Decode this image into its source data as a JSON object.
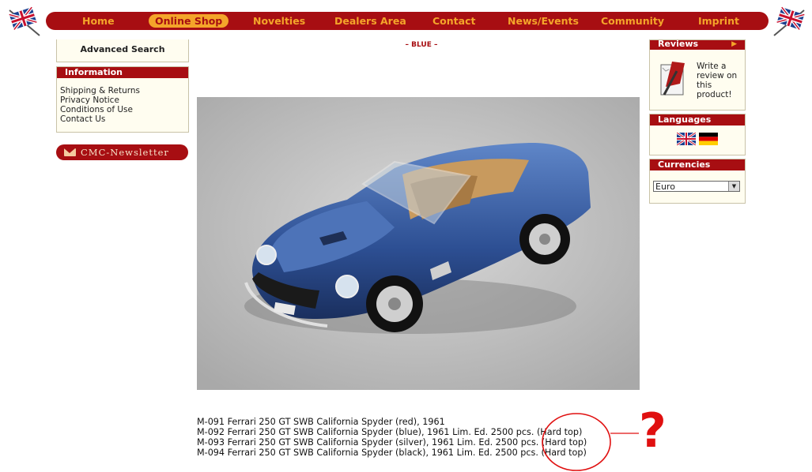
{
  "nav": {
    "items": [
      {
        "label": "Home"
      },
      {
        "label": "Online Shop",
        "active": true
      },
      {
        "label": "Novelties"
      },
      {
        "label": "Dealers Area"
      },
      {
        "label": "Contact"
      },
      {
        "label": "News/Events"
      },
      {
        "label": "Community"
      },
      {
        "label": "Imprint"
      }
    ]
  },
  "sidebar": {
    "advanced_search": "Advanced Search",
    "information": {
      "title": "Information",
      "links": [
        "Shipping & Returns",
        "Privacy Notice",
        "Conditions of Use",
        "Contact Us"
      ]
    },
    "newsletter": "CMC-Newsletter"
  },
  "product": {
    "variant_label": "– BLUE –",
    "models": [
      "M-091 Ferrari 250 GT SWB California Spyder (red), 1961",
      "M-092 Ferrari 250 GT SWB California Spyder (blue), 1961 Lim. Ed. 2500 pcs. (Hard top)",
      "M-093 Ferrari 250 GT SWB California Spyder (silver), 1961 Lim. Ed. 2500 pcs. (Hard top)",
      "M-094 Ferrari 250 GT SWB California Spyder (black), 1961 Lim. Ed. 2500 pcs. (Hard top)"
    ],
    "annotation_mark": "?"
  },
  "right": {
    "reviews": {
      "title": "Reviews",
      "text": "Write a review on this product!"
    },
    "languages": {
      "title": "Languages"
    },
    "currencies": {
      "title": "Currencies",
      "selected": "Euro"
    }
  },
  "colors": {
    "brand_red": "#a70e12",
    "nav_text": "#f4a52a",
    "box_bg": "#fffdf0",
    "annotation_red": "#e01010"
  }
}
